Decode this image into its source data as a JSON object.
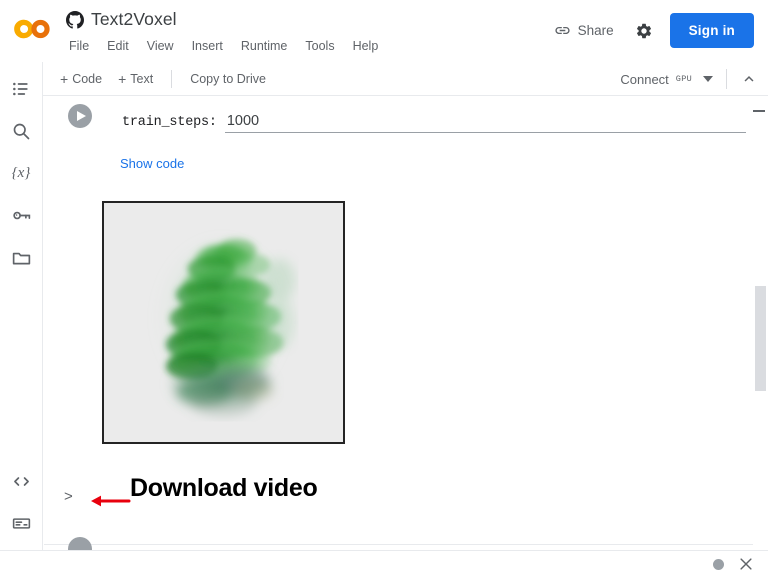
{
  "header": {
    "logo_name": "colab-logo",
    "repo_icon": "github-icon",
    "notebook_title": "Text2Voxel",
    "menus": [
      "File",
      "Edit",
      "View",
      "Insert",
      "Runtime",
      "Tools",
      "Help"
    ],
    "share_label": "Share",
    "share_icon": "link-icon",
    "settings_icon": "gear-icon",
    "signin_label": "Sign in",
    "accent_color": "#1a73e8"
  },
  "toolbar": {
    "add_code_label": "Code",
    "add_text_label": "Text",
    "plus_glyph": "+",
    "copy_to_drive_label": "Copy to Drive",
    "connect_label": "Connect",
    "gpu_badge": "GPU",
    "caret_icon": "chevron-down-icon",
    "collapse_icon": "chevron-up-icon"
  },
  "sidebar": {
    "items": [
      {
        "name": "table-of-contents",
        "icon": "list-icon"
      },
      {
        "name": "find-and-replace",
        "icon": "search-icon"
      },
      {
        "name": "variables",
        "icon": "variables-icon",
        "glyph": "{x}"
      },
      {
        "name": "secrets",
        "icon": "key-icon"
      },
      {
        "name": "files",
        "icon": "folder-icon"
      },
      {
        "name": "code-snippets",
        "icon": "code-brackets-icon",
        "glyph": "<>"
      },
      {
        "name": "terminal",
        "icon": "terminal-icon"
      }
    ]
  },
  "notebook": {
    "form_cell": {
      "run_icon": "play-icon",
      "param_label": "train_steps:",
      "param_value": "1000",
      "param_placeholder": "",
      "show_code_label": "Show code"
    },
    "output": {
      "name": "voxel-render-output",
      "alt": "volumetric green pine tree rendering",
      "background_color": "#ebebeb",
      "border_color": "#242424"
    },
    "markdown_section": {
      "chevron_glyph": ">",
      "annotation_icon": "red-left-arrow",
      "annotation_color": "#e8000d",
      "heading": "Download video"
    }
  },
  "scrollbar": {
    "thumb_color": "#dadce0"
  },
  "status_bar": {
    "busy_indicator": "status-dot",
    "close_icon": "close-icon"
  }
}
